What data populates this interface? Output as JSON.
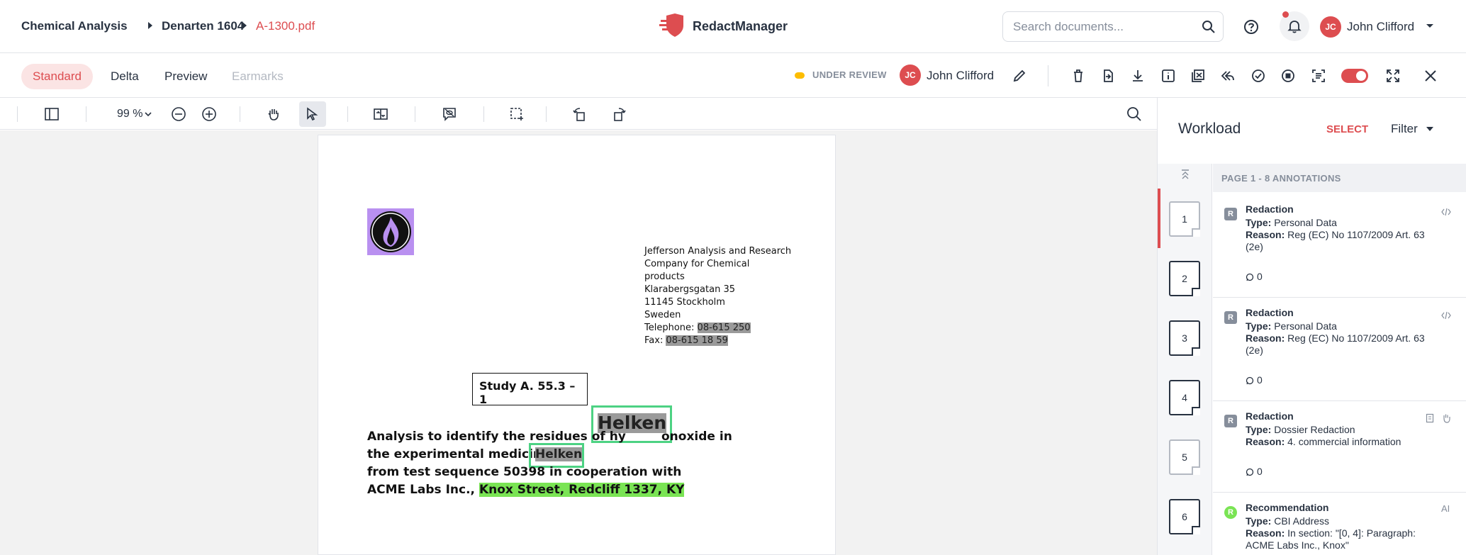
{
  "header": {
    "breadcrumbs": [
      "Chemical Analysis",
      "Denarten 1604",
      "A-1300.pdf"
    ],
    "app_name": "RedactManager",
    "search_placeholder": "Search documents...",
    "user": {
      "initials": "JC",
      "name": "John Clifford"
    }
  },
  "toolbar": {
    "tabs": [
      "Standard",
      "Delta",
      "Preview",
      "Earmarks"
    ],
    "status": "UNDER REVIEW",
    "assignee": {
      "initials": "JC",
      "name": "John Clifford"
    }
  },
  "pdf_tools": {
    "zoom": "99 %"
  },
  "document": {
    "address_lines": [
      "Jefferson Analysis and Research",
      "Company for Chemical",
      "products",
      "Klarabergsgatan 35",
      "11145 Stockholm",
      "Sweden"
    ],
    "telephone_label": "Telephone: ",
    "telephone_value": "08-615 250",
    "fax_label": "Fax: ",
    "fax_value": "08-615 18 59",
    "study_title": "Study A. 55.3 – 1",
    "floating_redaction": "Helken",
    "line1_a": "Analysis to identify the residues of hy",
    "line1_b": "onoxide in",
    "line2_a": "the experimental medicine ",
    "line2_redaction": "Helken",
    "line3": "from test sequence 50398 in cooperation with",
    "line4_a": "ACME Labs Inc., ",
    "line4_highlight": "Knox Street, Redcliff 1337, KY"
  },
  "sidebar": {
    "title": "Workload",
    "select_label": "SELECT",
    "filter_label": "Filter",
    "page_header": "PAGE 1 - 8 ANNOTATIONS",
    "pages": [
      "1",
      "2",
      "3",
      "4",
      "5",
      "6"
    ],
    "annotations": [
      {
        "badge": "R",
        "title": "Redaction",
        "type_label": "Type:",
        "type": "Personal Data",
        "reason_label": "Reason:",
        "reason": "Reg (EC) No 1107/2009 Art. 63 (2e)",
        "comments": "0"
      },
      {
        "badge": "R",
        "title": "Redaction",
        "type_label": "Type:",
        "type": "Personal Data",
        "reason_label": "Reason:",
        "reason": "Reg (EC) No 1107/2009 Art. 63 (2e)",
        "comments": "0"
      },
      {
        "badge": "R",
        "title": "Redaction",
        "type_label": "Type:",
        "type": "Dossier Redaction",
        "reason_label": "Reason:",
        "reason": "4. commercial information",
        "comments": "0"
      },
      {
        "badge": "R",
        "title": "Recommendation",
        "type_label": "Type:",
        "type": "CBI Address",
        "reason_label": "Reason:",
        "reason": "In section: \"[0, 4]: Paragraph: ACME Labs Inc., Knox\"",
        "tag": "AI"
      }
    ]
  }
}
